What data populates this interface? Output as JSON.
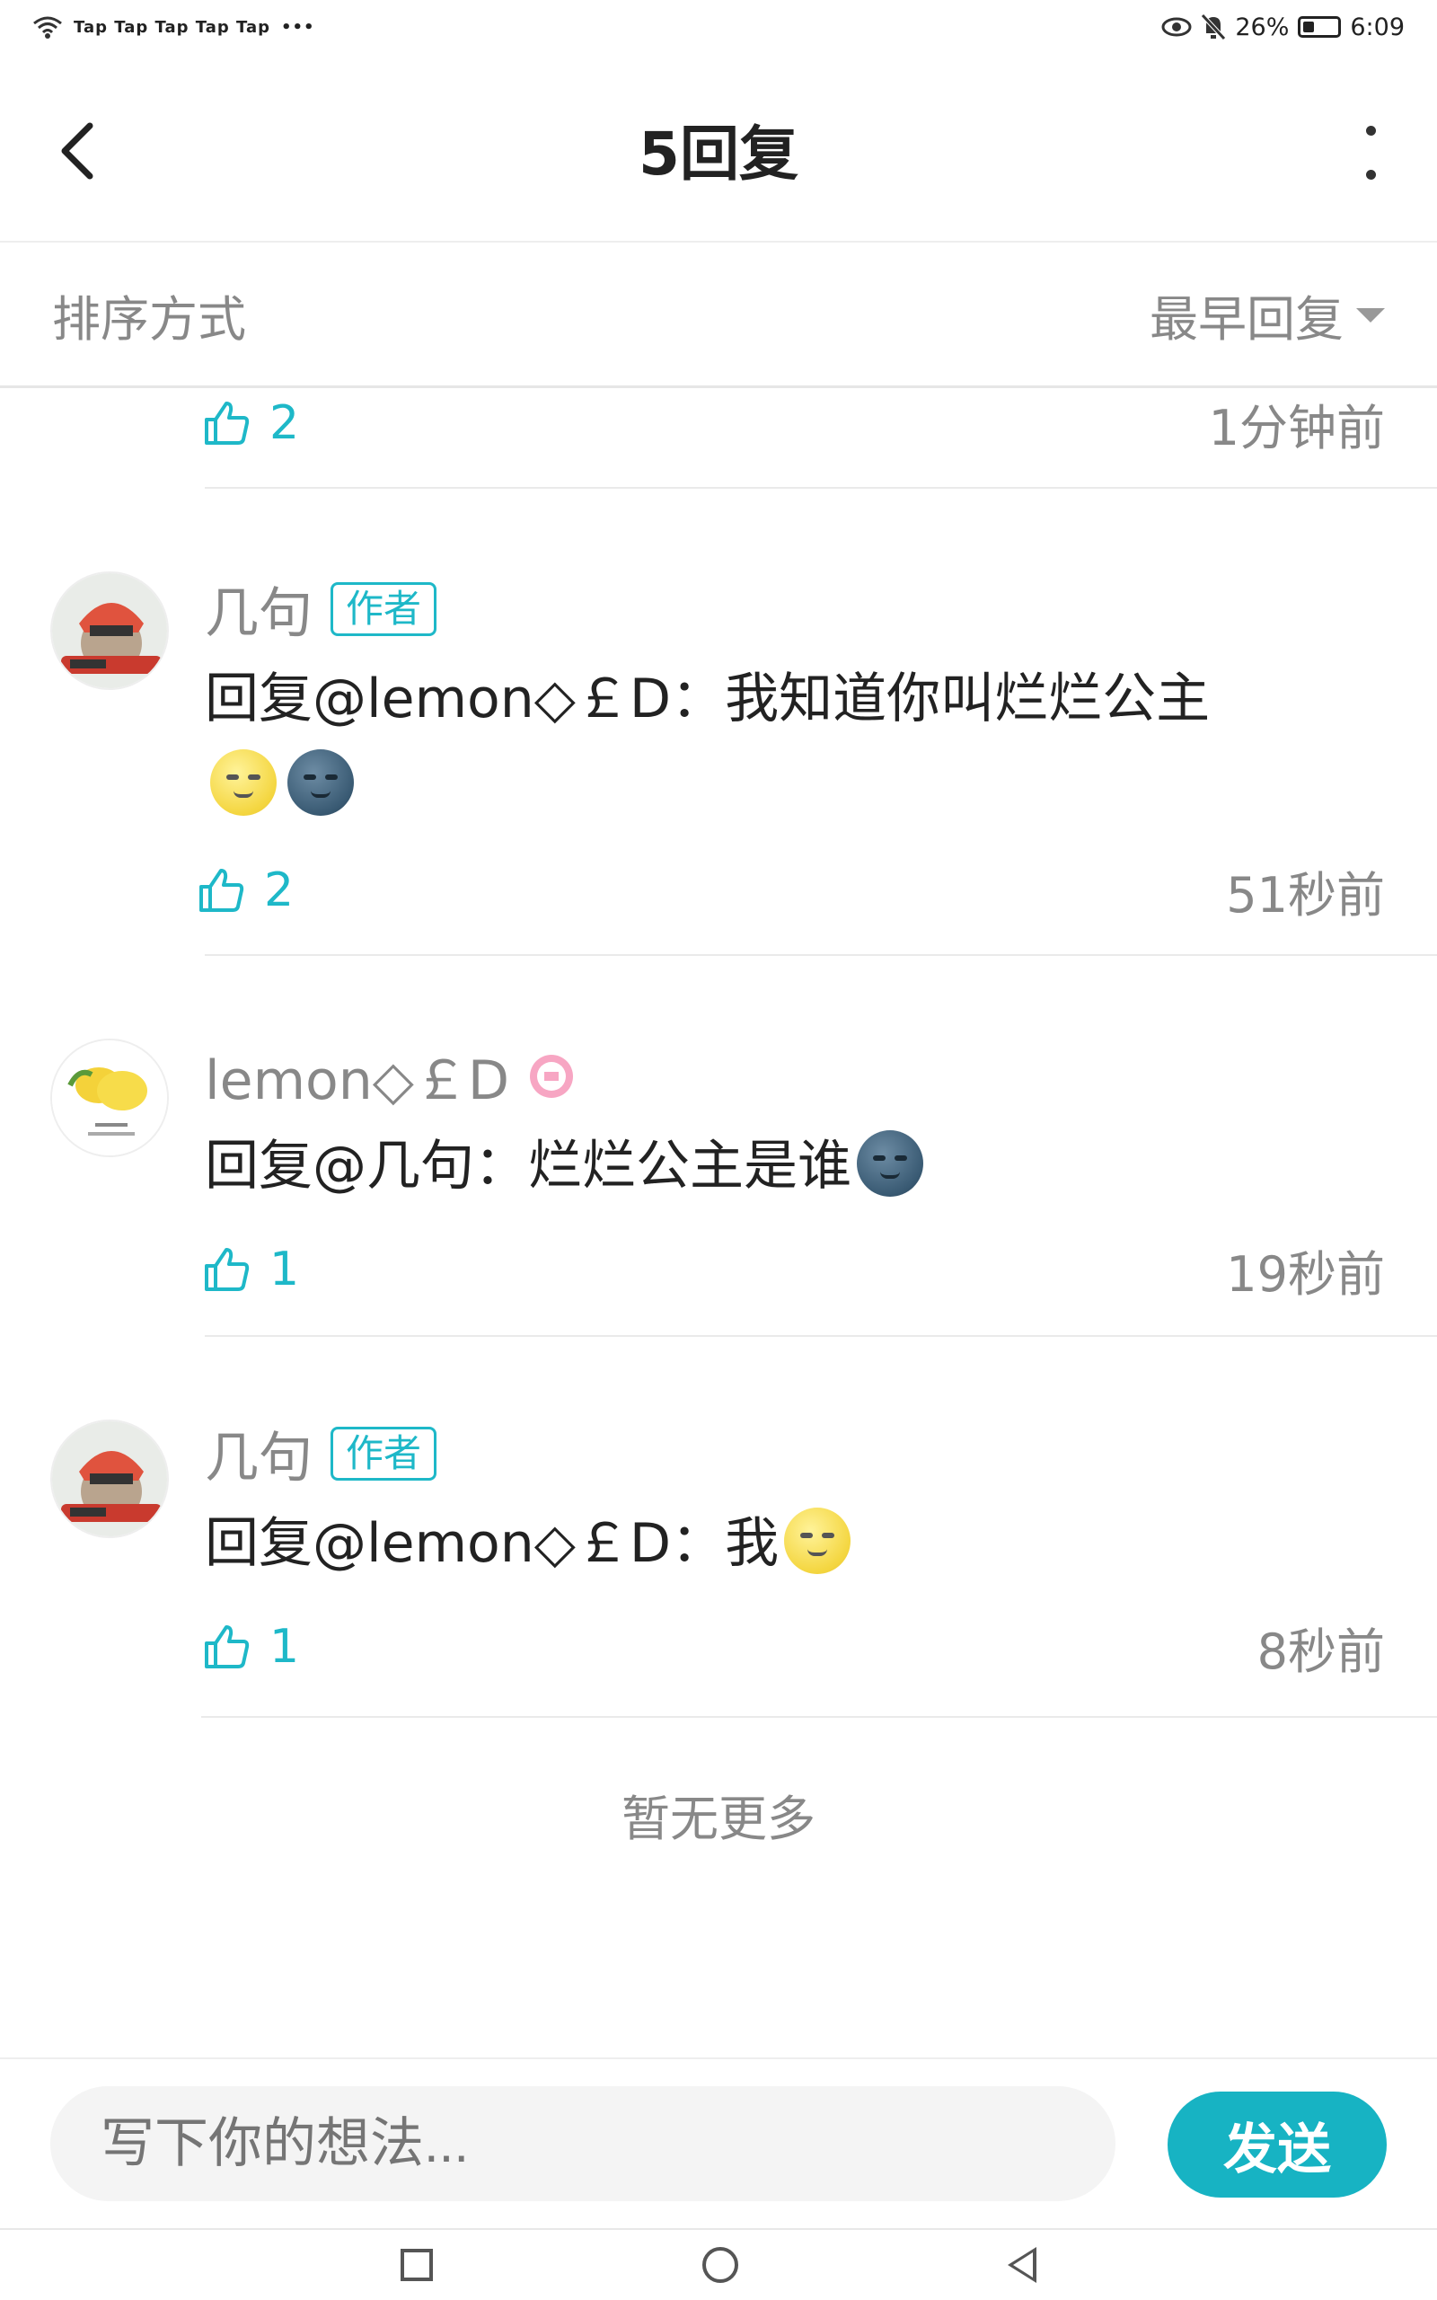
{
  "status_bar": {
    "carrier": "Tap Tap Tap Tap Tap",
    "dots": "•••",
    "battery": "26%",
    "time": "6:09"
  },
  "header": {
    "title": "5回复"
  },
  "sort": {
    "label": "排序方式",
    "value": "最早回复"
  },
  "top_row": {
    "likes": "2",
    "time": "1分钟前"
  },
  "comments": [
    {
      "author": "几句",
      "badge": "作者",
      "text": "回复@lemon◇￡D：我知道你叫烂烂公主",
      "emojis": [
        "sun",
        "dark"
      ],
      "likes": "2",
      "time": "51秒前"
    },
    {
      "author": "lemon◇￡D",
      "text": "回复@几句：烂烂公主是谁",
      "emojis": [
        "dark"
      ],
      "likes": "1",
      "time": "19秒前"
    },
    {
      "author": "几句",
      "badge": "作者",
      "text": "回复@lemon◇￡D：我",
      "emojis": [
        "sun"
      ],
      "likes": "1",
      "time": "8秒前"
    }
  ],
  "footer_text": "暂无更多",
  "input": {
    "placeholder": "写下你的想法...",
    "send_label": "发送"
  },
  "colors": {
    "accent": "#17b3c3",
    "muted": "#888888"
  }
}
